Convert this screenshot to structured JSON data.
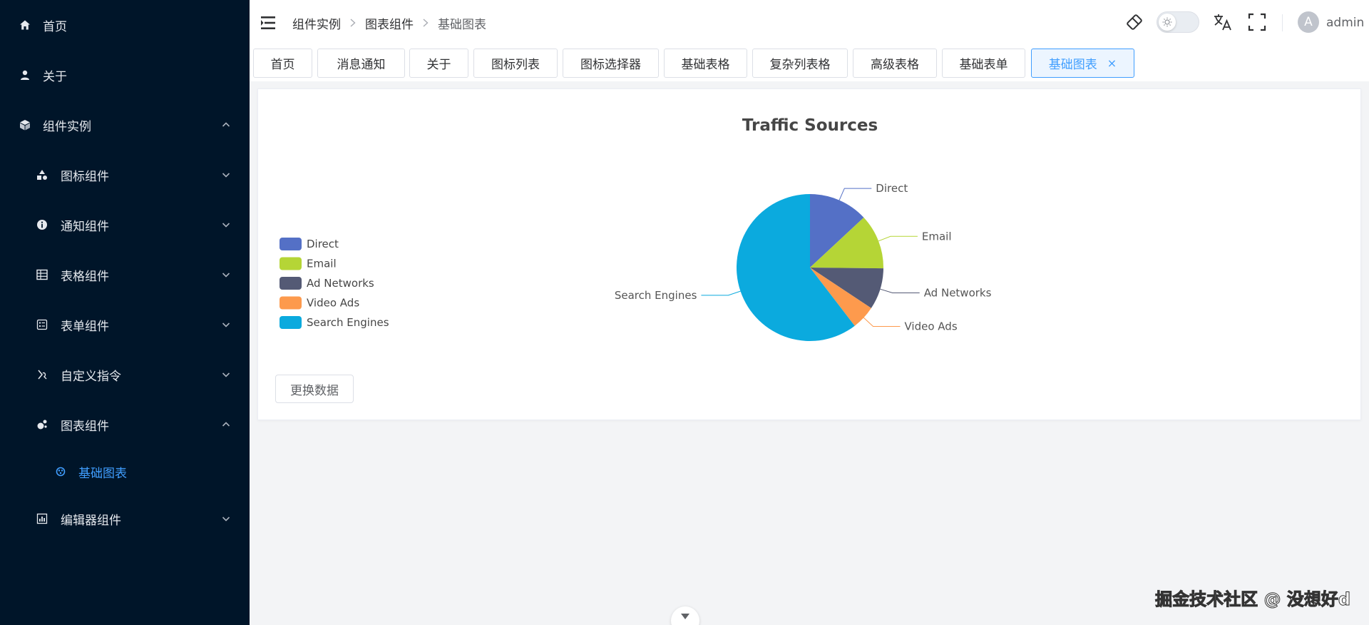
{
  "sidebar": {
    "items": [
      {
        "label": "首页",
        "icon": "home-icon"
      },
      {
        "label": "关于",
        "icon": "user-icon"
      },
      {
        "label": "组件实例",
        "icon": "cube-icon"
      },
      {
        "label": "图标组件",
        "icon": "shapes-icon"
      },
      {
        "label": "通知组件",
        "icon": "info-icon"
      },
      {
        "label": "表格组件",
        "icon": "table-icon"
      },
      {
        "label": "表单组件",
        "icon": "form-icon"
      },
      {
        "label": "自定义指令",
        "icon": "directive-icon"
      },
      {
        "label": "图表组件",
        "icon": "chart-icon"
      },
      {
        "label": "基础图表",
        "icon": "palette-icon"
      },
      {
        "label": "编辑器组件",
        "icon": "editor-icon"
      }
    ]
  },
  "header": {
    "breadcrumb": [
      "组件实例",
      "图表组件",
      "基础图表"
    ],
    "avatar_letter": "A",
    "username": "admin"
  },
  "tabs": [
    {
      "label": "首页"
    },
    {
      "label": "消息通知"
    },
    {
      "label": "关于"
    },
    {
      "label": "图标列表"
    },
    {
      "label": "图标选择器"
    },
    {
      "label": "基础表格"
    },
    {
      "label": "复杂列表格"
    },
    {
      "label": "高级表格"
    },
    {
      "label": "基础表单"
    },
    {
      "label": "基础图表",
      "closable_icon": "×"
    }
  ],
  "content": {
    "change_button": "更换数据"
  },
  "chart_data": {
    "type": "pie",
    "title": "Traffic Sources",
    "legend_position": "left",
    "categories": [
      "Direct",
      "Email",
      "Ad Networks",
      "Video Ads",
      "Search Engines"
    ],
    "values": [
      335,
      310,
      234,
      135,
      1548
    ],
    "colors": [
      "#5470c6",
      "#b5d536",
      "#545a75",
      "#fd9a4d",
      "#0baade"
    ]
  },
  "watermark": "掘金技术社区 @ 没想好d",
  "colors": {
    "sidebar_bg": "#001529",
    "accent": "#409eff"
  }
}
